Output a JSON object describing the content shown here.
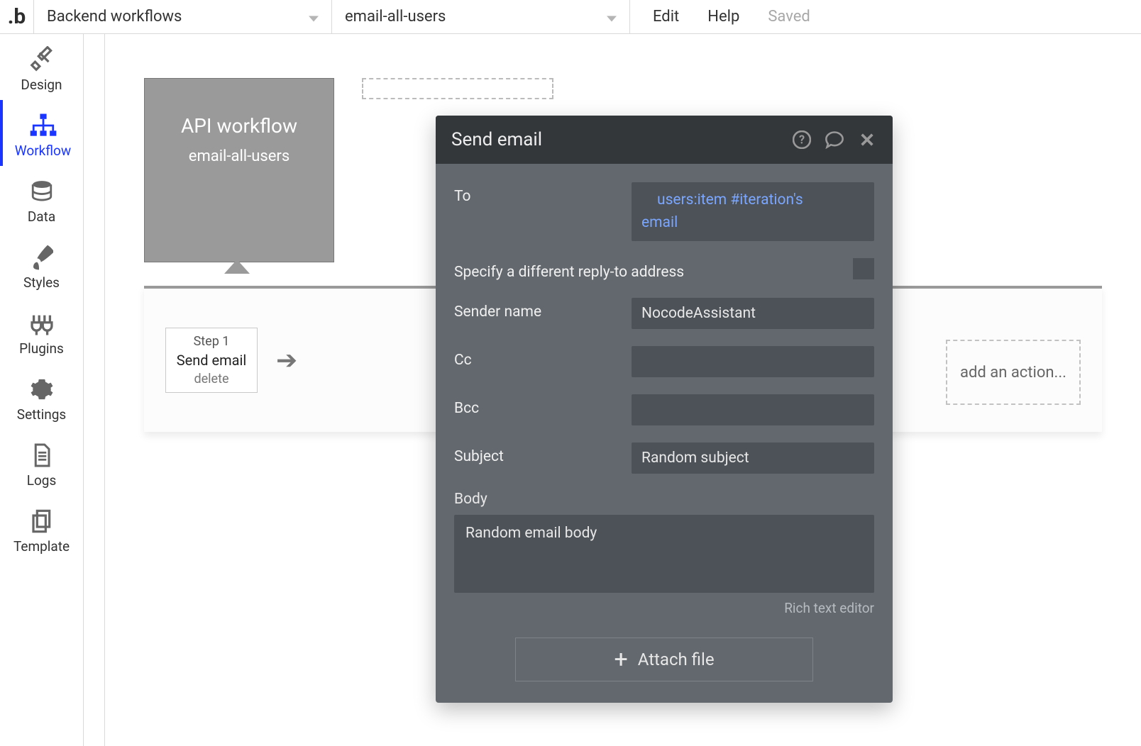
{
  "topbar": {
    "section": "Backend workflows",
    "workflow": "email-all-users",
    "edit": "Edit",
    "help": "Help",
    "saved": "Saved"
  },
  "nav": {
    "design": "Design",
    "workflow": "Workflow",
    "data": "Data",
    "styles": "Styles",
    "plugins": "Plugins",
    "settings": "Settings",
    "logs": "Logs",
    "template": "Template"
  },
  "wfCard": {
    "title": "API workflow",
    "subtitle": "email-all-users"
  },
  "step1": {
    "line1": "Step 1",
    "line2": "Send email",
    "line3": "delete"
  },
  "addAction": "add an action...",
  "panel": {
    "title": "Send email",
    "labels": {
      "to": "To",
      "replyTo": "Specify a different reply-to address",
      "senderName": "Sender name",
      "cc": "Cc",
      "bcc": "Bcc",
      "subject": "Subject",
      "body": "Body",
      "rte": "Rich text editor",
      "attach": "Attach file"
    },
    "values": {
      "to_line1": "users:item #iteration's",
      "to_line2": "email",
      "senderName": "NocodeAssistant",
      "cc": "",
      "bcc": "",
      "subject": "Random subject",
      "body": "Random email body"
    }
  }
}
